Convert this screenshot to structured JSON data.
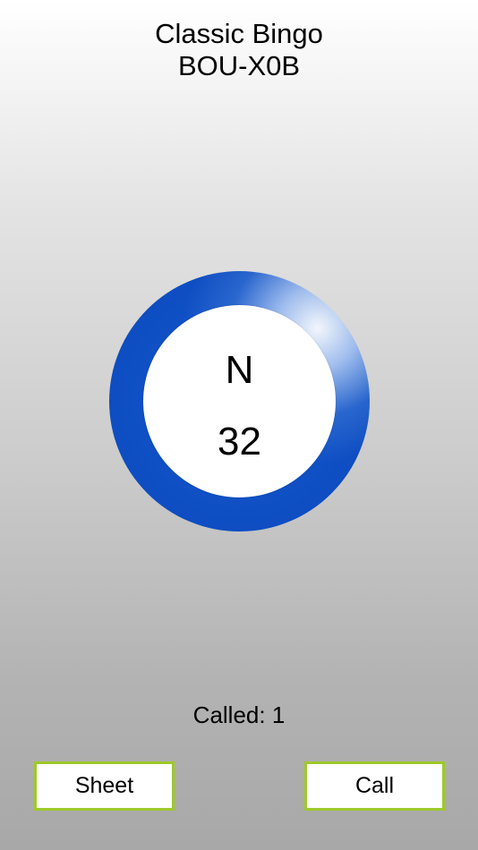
{
  "header": {
    "title": "Classic Bingo",
    "code": "BOU-X0B"
  },
  "ball": {
    "letter": "N",
    "number": "32",
    "ring_color": "#0f4fc4",
    "face_color": "#ffffff"
  },
  "status": {
    "called_label": "Called:",
    "called_count": "1"
  },
  "buttons": {
    "sheet_label": "Sheet",
    "call_label": "Call",
    "border_color": "#9ec92a"
  }
}
